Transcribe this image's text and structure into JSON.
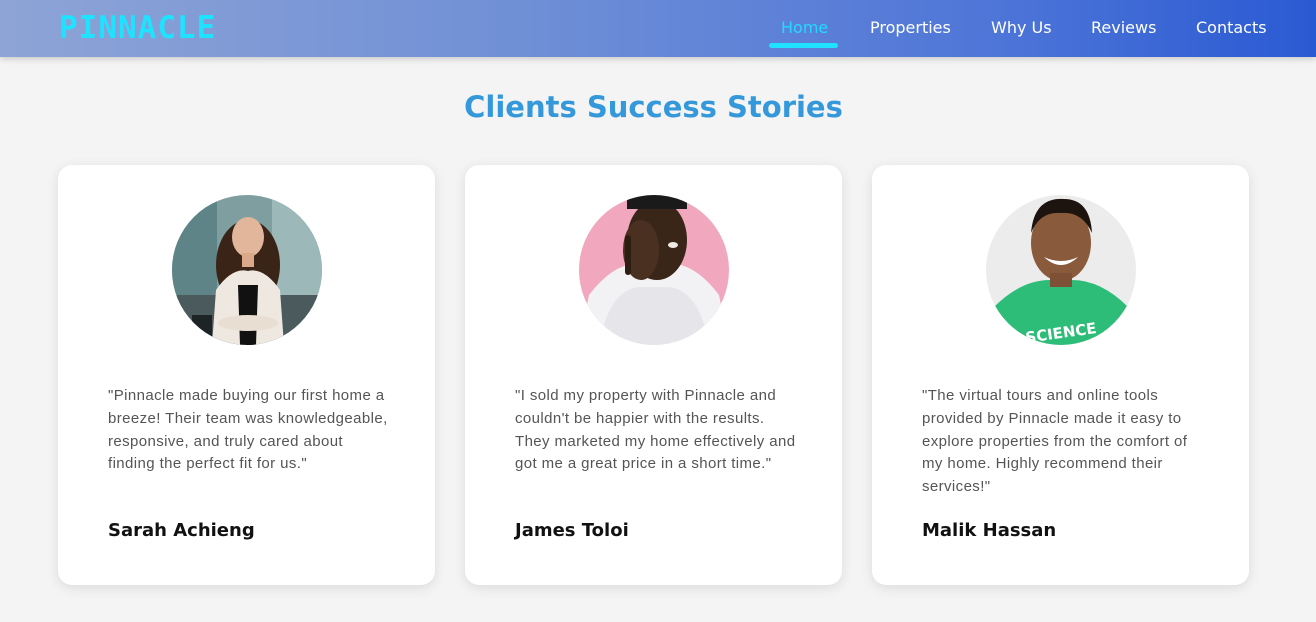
{
  "nav": {
    "logo": "PINNACLE",
    "links": [
      "Home",
      "Properties",
      "Why Us",
      "Reviews",
      "Contacts"
    ],
    "active": "Home"
  },
  "section": {
    "title": "Clients Success Stories"
  },
  "testimonials": [
    {
      "quote": "\"Pinnacle made buying our first home a breeze! Their team was knowledgeable, responsive, and truly cared about finding the perfect fit for us.\"",
      "name": "Sarah Achieng"
    },
    {
      "quote": "\"I sold my property with Pinnacle and couldn't be happier with the results. They marketed my home effectively and got me a great price in a short time.\"",
      "name": "James Toloi"
    },
    {
      "quote": "\"The virtual tours and online tools provided by Pinnacle made it easy to explore properties from the comfort of my home. Highly recommend their services!\"",
      "name": "Malik Hassan"
    }
  ],
  "shirt_text": "SCIENCE",
  "colors": {
    "accent": "#1fe2ff",
    "title": "#3498db",
    "nav_gradient_start": "#8ea4d6",
    "nav_gradient_end": "#2a5ad3"
  }
}
